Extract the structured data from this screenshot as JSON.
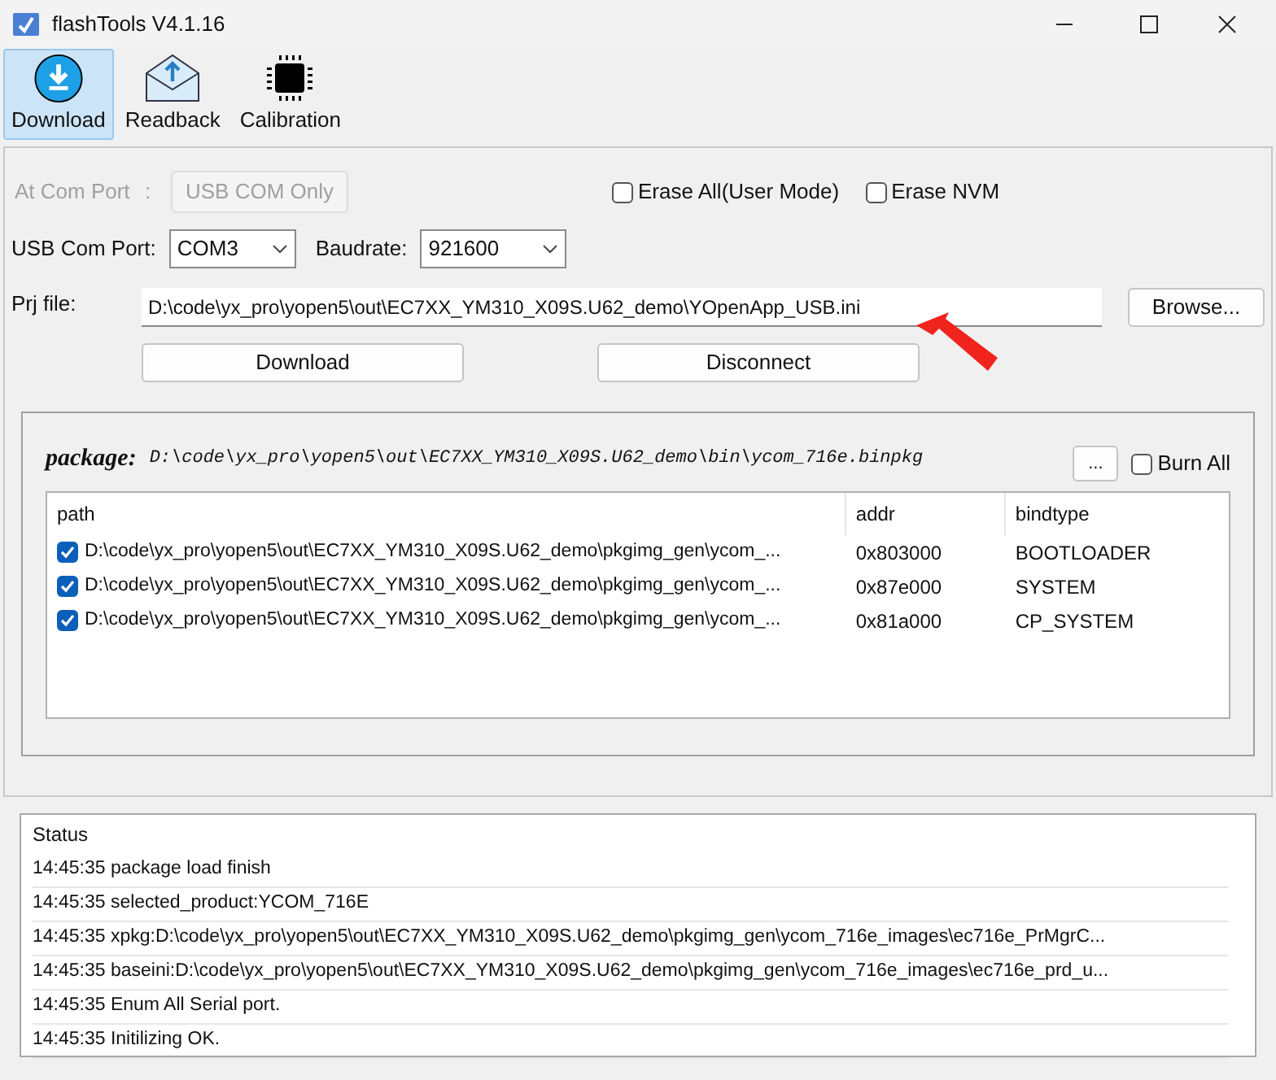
{
  "window": {
    "title": "flashTools V4.1.16"
  },
  "toolbar": [
    {
      "label": "Download",
      "kind": "download",
      "selected": true
    },
    {
      "label": "Readback",
      "kind": "readback",
      "selected": false
    },
    {
      "label": "Calibration",
      "kind": "calibration",
      "selected": false
    }
  ],
  "at_com_port": {
    "label": "At Com Port",
    "separator": ":",
    "button": "USB COM Only",
    "disabled": true
  },
  "erase_all": {
    "label": "Erase All(User Mode)",
    "checked": false
  },
  "erase_nvm": {
    "label": "Erase NVM",
    "checked": false
  },
  "usb_com_port": {
    "label": "USB Com Port:",
    "value": "COM3"
  },
  "baudrate": {
    "label": "Baudrate:",
    "value": "921600"
  },
  "prj_file": {
    "label": "Prj file:",
    "value": "D:\\code\\yx_pro\\yopen5\\out\\EC7XX_YM310_X09S.U62_demo\\YOpenApp_USB.ini",
    "browse": "Browse..."
  },
  "actions": [
    "Download",
    "Disconnect"
  ],
  "package": {
    "label": "package:",
    "path": "D:\\code\\yx_pro\\yopen5\\out\\EC7XX_YM310_X09S.U62_demo\\bin\\ycom_716e.binpkg",
    "more": "...",
    "burn_all": {
      "label": "Burn All",
      "checked": false
    }
  },
  "table": {
    "columns": [
      "path",
      "addr",
      "bindtype"
    ],
    "rows": [
      {
        "checked": true,
        "path": "D:\\code\\yx_pro\\yopen5\\out\\EC7XX_YM310_X09S.U62_demo\\pkgimg_gen\\ycom_...",
        "addr": "0x803000",
        "bindtype": "BOOTLOADER"
      },
      {
        "checked": true,
        "path": "D:\\code\\yx_pro\\yopen5\\out\\EC7XX_YM310_X09S.U62_demo\\pkgimg_gen\\ycom_...",
        "addr": "0x87e000",
        "bindtype": "SYSTEM"
      },
      {
        "checked": true,
        "path": "D:\\code\\yx_pro\\yopen5\\out\\EC7XX_YM310_X09S.U62_demo\\pkgimg_gen\\ycom_...",
        "addr": "0x81a000",
        "bindtype": "CP_SYSTEM"
      }
    ]
  },
  "status": {
    "heading": "Status",
    "lines": [
      "14:45:35 package load finish",
      "14:45:35 selected_product:YCOM_716E",
      "14:45:35 xpkg:D:\\code\\yx_pro\\yopen5\\out\\EC7XX_YM310_X09S.U62_demo\\pkgimg_gen\\ycom_716e_images\\ec716e_PrMgrC...",
      "14:45:35 baseini:D:\\code\\yx_pro\\yopen5\\out\\EC7XX_YM310_X09S.U62_demo\\pkgimg_gen\\ycom_716e_images\\ec716e_prd_u...",
      "14:45:35 Enum All Serial port.",
      "14:45:35 Initilizing OK."
    ]
  }
}
